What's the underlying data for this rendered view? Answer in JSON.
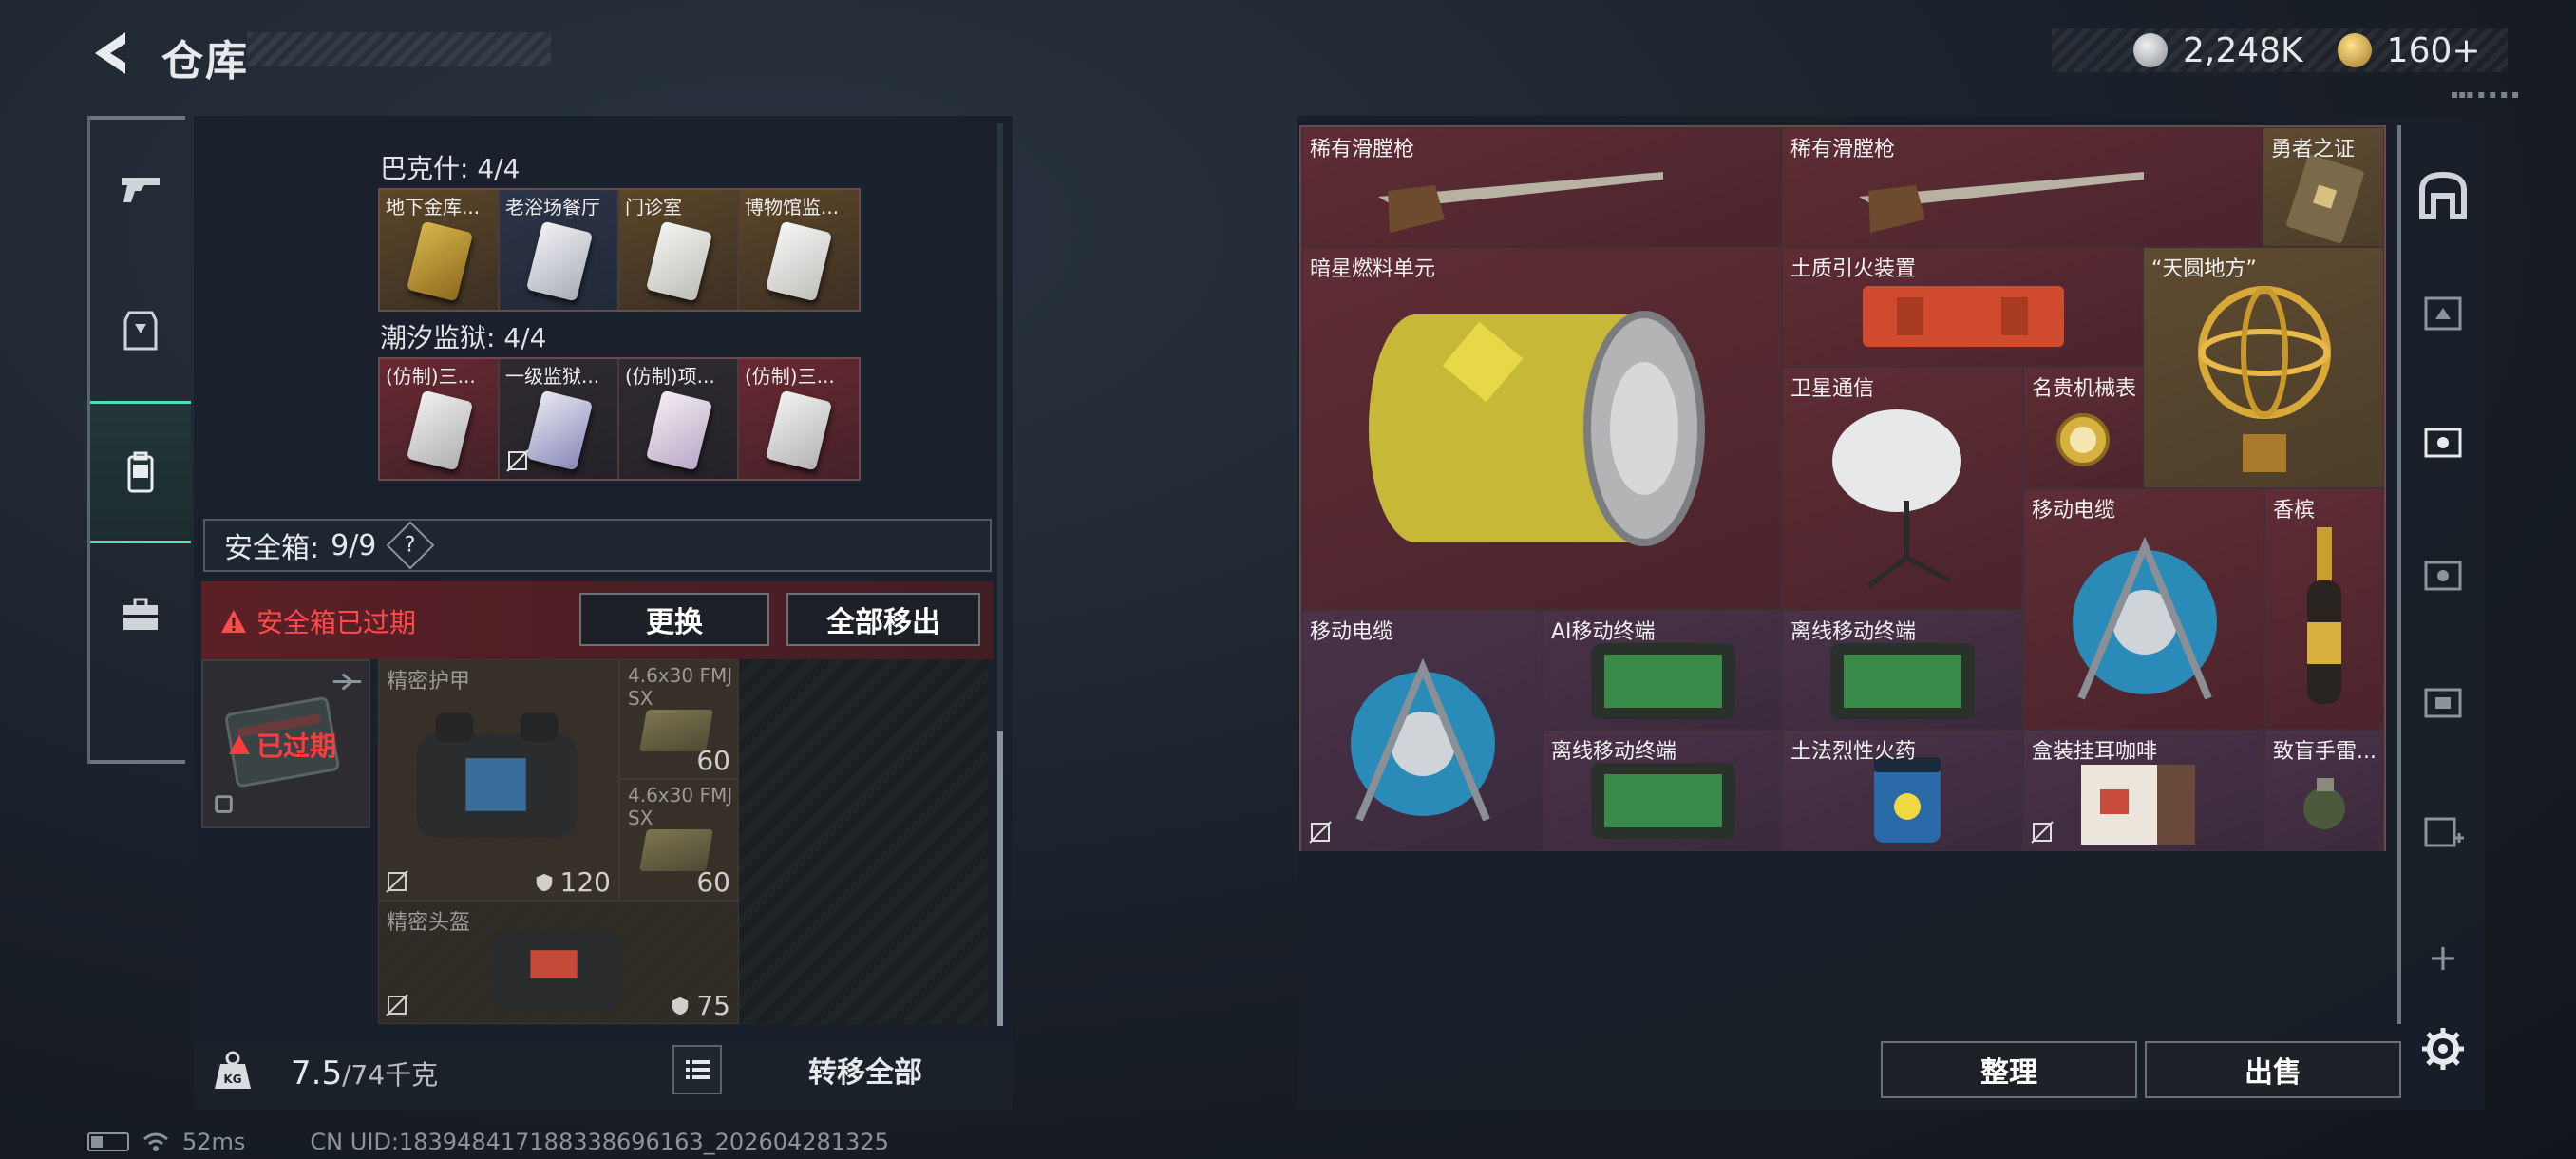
{
  "header": {
    "title": "仓库",
    "silver_amount": "2,248K",
    "gold_amount": "160+",
    "version_tag": "▪▪▪ ▪ ▪ ▪ ▪"
  },
  "left_panel": {
    "group_bakeshi": {
      "title": "巴克什: 4/4",
      "cards": [
        "地下金库...",
        "老浴场餐厅",
        "门诊室",
        "博物馆监..."
      ]
    },
    "group_chaoxi": {
      "title": "潮汐监狱: 4/4",
      "cards": [
        "(仿制)三...",
        "一级监狱...",
        "(仿制)项...",
        "(仿制)三..."
      ]
    },
    "safebox": {
      "title": "安全箱:",
      "count": "9/9",
      "help": "?",
      "expired_msg": "安全箱已过期",
      "replace_btn": "更换",
      "move_all_btn": "全部移出",
      "slot_expired": "已过期",
      "items": {
        "armor_label": "精密护甲",
        "armor_durability": "120",
        "ammo1_label": "4.6x30 FMJ SX",
        "ammo1_count": "60",
        "ammo2_label": "4.6x30 FMJ SX",
        "ammo2_count": "60",
        "helmet_label": "精密头盔",
        "helmet_durability": "75"
      }
    },
    "weight": {
      "current": "7.5",
      "max": "/74千克",
      "icon_text": "KG"
    },
    "transfer_all_btn": "转移全部"
  },
  "status": {
    "ping": "52ms",
    "uid": "CN UID:1839484171883386​96163_202604281325"
  },
  "stash": {
    "items": [
      {
        "name": "稀有滑膛枪"
      },
      {
        "name": "稀有滑膛枪"
      },
      {
        "name": "勇者之证"
      },
      {
        "name": "暗星燃料单元"
      },
      {
        "name": "土质引火装置"
      },
      {
        "name": "“天圆地方”"
      },
      {
        "name": "卫星通信"
      },
      {
        "name": "名贵机械表"
      },
      {
        "name": "移动电缆"
      },
      {
        "name": "香槟"
      },
      {
        "name": "移动电缆"
      },
      {
        "name": "AI移动终端"
      },
      {
        "name": "离线移动终端"
      },
      {
        "name": "离线移动终端"
      },
      {
        "name": "土法烈性火药"
      },
      {
        "name": "盒装挂耳咖啡"
      },
      {
        "name": "致盲手雷..."
      }
    ]
  },
  "buttons": {
    "organize": "整理",
    "sell": "出售"
  },
  "right_rail": {
    "add": "+"
  },
  "colors": {
    "accent_green": "#4de0b2",
    "expired_red": "#ff4b4b",
    "rare_red_bg": "#5e2c34"
  }
}
